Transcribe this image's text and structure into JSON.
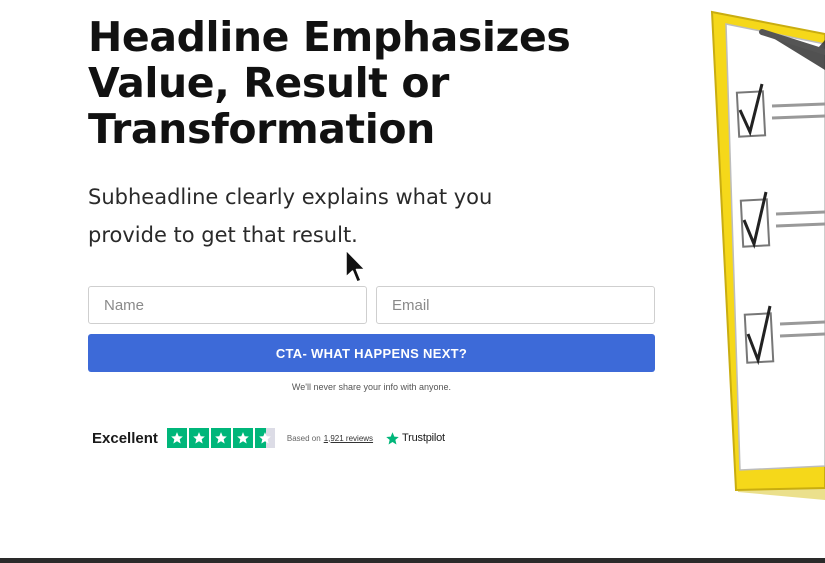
{
  "hero": {
    "headline_line1": "Headline Emphasizes",
    "headline_line2": "Value, Result or",
    "headline_line3": "Transformation",
    "subheadline_line1": "Subheadline clearly explains what you",
    "subheadline_line2": "provide to get that result."
  },
  "form": {
    "name_placeholder": "Name",
    "email_placeholder": "Email",
    "cta_label": "CTA- WHAT HAPPENS NEXT?",
    "privacy_note": "We'll never share your info with anyone."
  },
  "trust": {
    "rating_word": "Excellent",
    "stars_rating": 4.5,
    "stars_max": 5,
    "based_on": "Based on",
    "reviews_count": "1,921 reviews",
    "brand": "Trustpilot"
  },
  "colors": {
    "cta": "#3d6ad8",
    "trustpilot_green": "#00b67a",
    "clipboard_yellow": "#f5d81a"
  },
  "icons": {
    "clipboard": "clipboard-checklist-icon",
    "star": "star-icon",
    "cursor": "mouse-pointer-icon"
  }
}
